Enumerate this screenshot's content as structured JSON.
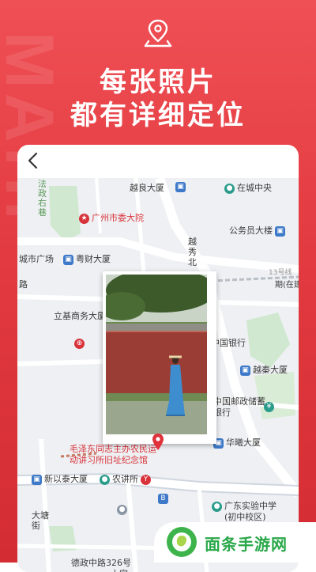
{
  "headline": {
    "line1": "每张照片",
    "line2": "都有详细定位"
  },
  "watermark": "MAHI",
  "map": {
    "labels": {
      "yueliang": "越良大厦",
      "zaicheng": "在城中央",
      "gongan": "法政右巷",
      "shiwei": "广州市委大院",
      "gongwuyuan": "公务员大楼",
      "shiguangchang": "城市广场",
      "yuecai": "粤财大厦",
      "yuexiu": "越秀北",
      "road13": "13号线",
      "road_zaijian": "期(在建)",
      "lu": "路",
      "liji": "立基商务大厦",
      "bank": "中国银行",
      "yuekang": "越秦大厦",
      "post": "中国邮政储蓄银行",
      "mao1": "毛泽东同志主办农民运",
      "mao2": "动讲习所旧址纪念馆",
      "huaxi": "华曦大厦",
      "xinyitai": "新以泰大厦",
      "nongjiangsuo": "农讲所",
      "shiyan1": "广东实验中学",
      "shiyan2": "(初中校区)",
      "datang": "大塘街",
      "dezheng": "德政中路326号",
      "dajia": "大家"
    }
  },
  "branding": {
    "logo_text": "面条手游网"
  },
  "colors": {
    "brand_red": "#e23a40",
    "logo_green": "#2aa84a"
  }
}
